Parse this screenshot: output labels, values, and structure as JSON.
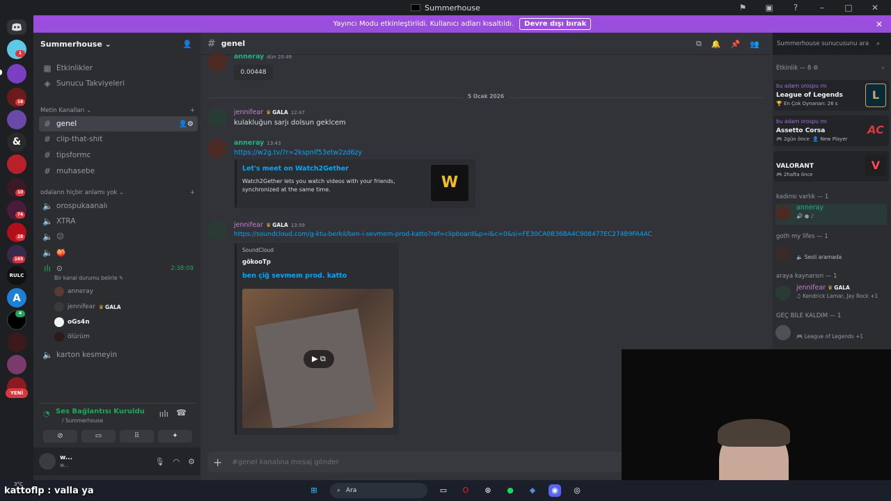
{
  "window": {
    "title": "Summerhouse"
  },
  "banner": {
    "text": "Yayıncı Modu etkinleştirildi. Kullanıcı adları kısaltıldı.",
    "button": "Devre dışı bırak"
  },
  "guilds": {
    "badges": [
      "1",
      "16",
      "10",
      "74",
      "28",
      "165",
      "4"
    ],
    "new_label": "YENİ"
  },
  "server": {
    "name": "Summerhouse"
  },
  "sidebar": {
    "items": [
      {
        "label": "Etkinlikler"
      },
      {
        "label": "Sunucu Takviyeleri"
      }
    ],
    "text_category": "Metin Kanalları",
    "text_channels": [
      "genel",
      "clip-that-shit",
      "tipsformc",
      "muhasebe"
    ],
    "voice_category": "odaların hiçbir anlamı yok",
    "voice_channels": [
      "orospukaanalı",
      "XTRA",
      "😕",
      "🍑"
    ],
    "active_voice": {
      "timer": "2:38:09",
      "status": "Bir kanal durumu belirle"
    },
    "voice_users": [
      "anneray",
      "jennifear",
      "oGs4n",
      "ölürüm"
    ],
    "gala_tag": "GALA",
    "last_channel": "karton kesmeyin"
  },
  "voice_panel": {
    "status": "Ses Bağlantısı Kuruldu",
    "sub": "/ Summerhouse"
  },
  "user_panel": {
    "name": "w...",
    "status": "w..."
  },
  "channel": {
    "name": "genel",
    "search_placeholder": "Summerhouse sunucusunu ara"
  },
  "messages": {
    "m1": {
      "author": "anneray",
      "time": "dün 20:49",
      "text": "0.00448"
    },
    "date_divider": "5 Ocak 2026",
    "m2": {
      "author": "jennifear",
      "tag": "GALA",
      "time": "12:47",
      "text": "kulakluğun sarjı dolsun geklcem"
    },
    "m3": {
      "author": "anneray",
      "time": "13:43",
      "link": "https://w2g.tv/?r=2kspnlf53etw2zd6zy",
      "embed": {
        "title": "Let's meet on Watch2Gether",
        "desc1": "Watch2Gether lets you watch videos with your friends,",
        "desc2": "synchronized at the same time."
      }
    },
    "m4": {
      "author": "jennifear",
      "tag": "GALA",
      "time": "13:59",
      "link": "https://soundcloud.com/g-ktu-berkil/ben-i-sevmem-prod-katto?ref=clipboard&p=i&c=0&si=FE30CA0B36BA4C908477EC274B9FA4AC",
      "embed": {
        "provider": "SoundCloud",
        "author": "gökooTp",
        "title": "ben çiğ sevmem prod. katto"
      }
    }
  },
  "composer": {
    "placeholder": "#genel kanalına mesaj gönder"
  },
  "members": {
    "activity_header": "Etkinlik — 8",
    "activities": [
      {
        "user": "bu adam orospu mı",
        "game": "League of Legends",
        "detail": "En Çok Oynanan: 26 s"
      },
      {
        "user": "bu adam orospu mı",
        "game": "Assetto Corsa",
        "detail": "2gün önce",
        "extra": "New Player"
      },
      {
        "user": "",
        "game": "VALORANT",
        "detail": "2hafta önce"
      }
    ],
    "groups": [
      {
        "header": "kadınsı varlık — 1",
        "name": "anneray",
        "status": ""
      },
      {
        "header": "goth my lifes — 1",
        "name": "",
        "status": "Sesli aramada"
      },
      {
        "header": "araya kaynarsın — 1",
        "name": "jennifear",
        "tag": "GALA",
        "status": "Kendrick Lamar, Jay Rock +1"
      },
      {
        "header": "GEÇ BİLE KALDIM — 1",
        "name": "",
        "status": "League of Legends +1"
      }
    ]
  },
  "taskbar": {
    "search": "Ara"
  },
  "overlay": {
    "chat": "kattoflp : valla ya",
    "weather": "3°C"
  },
  "colors": {
    "banner": "#9b4dde",
    "accent": "#00a8fc",
    "green": "#23a55a",
    "red": "#da373c"
  }
}
